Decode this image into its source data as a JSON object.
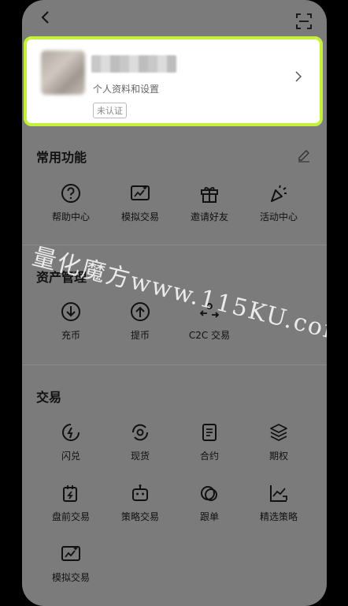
{
  "profile": {
    "subtitle": "个人资料和设置",
    "badge": "未认证"
  },
  "sections": {
    "common": {
      "title": "常用功能"
    },
    "assets": {
      "title": "资产管理"
    },
    "trade": {
      "title": "交易"
    }
  },
  "common_items": [
    {
      "label": "帮助中心",
      "icon": "help-icon"
    },
    {
      "label": "模拟交易",
      "icon": "simulate-icon"
    },
    {
      "label": "邀请好友",
      "icon": "gift-icon"
    },
    {
      "label": "活动中心",
      "icon": "party-icon"
    }
  ],
  "asset_items": [
    {
      "label": "充币",
      "icon": "deposit-icon"
    },
    {
      "label": "提币",
      "icon": "withdraw-icon"
    },
    {
      "label": "C2C 交易",
      "icon": "c2c-icon"
    }
  ],
  "trade_items": [
    {
      "label": "闪兑",
      "icon": "flash-icon"
    },
    {
      "label": "现货",
      "icon": "spot-icon"
    },
    {
      "label": "合约",
      "icon": "contract-icon"
    },
    {
      "label": "期权",
      "icon": "options-icon"
    },
    {
      "label": "盘前交易",
      "icon": "premarket-icon"
    },
    {
      "label": "策略交易",
      "icon": "bot-icon"
    },
    {
      "label": "跟单",
      "icon": "copy-trade-icon"
    },
    {
      "label": "精选策略",
      "icon": "chart-icon"
    },
    {
      "label": "模拟交易",
      "icon": "simulate-icon"
    }
  ],
  "watermark": "量化魔方www.115KU.com",
  "colors": {
    "highlight": "#c4f23a",
    "background": "#7b7b7b"
  }
}
